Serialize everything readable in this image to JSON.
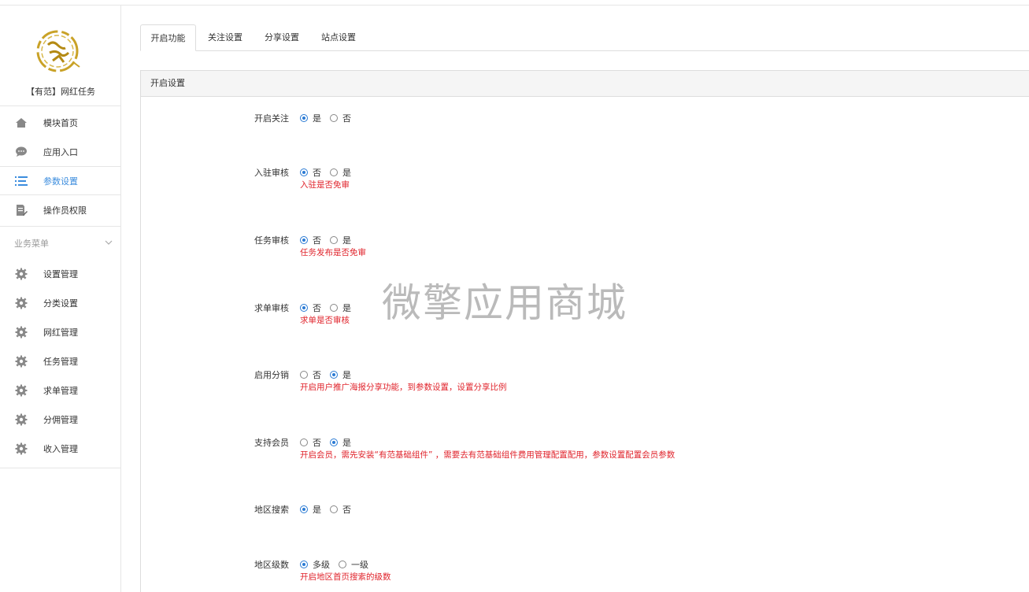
{
  "app_name": "【有范】网红任务",
  "nav": {
    "items": [
      {
        "label": "模块首页",
        "icon": "home-icon"
      },
      {
        "label": "应用入口",
        "icon": "chat-bubble-icon"
      },
      {
        "label": "参数设置",
        "icon": "list-icon"
      },
      {
        "label": "操作员权限",
        "icon": "edit-doc-icon"
      }
    ],
    "section_title": "业务菜单",
    "biz_items": [
      {
        "label": "设置管理",
        "icon": "gear-icon"
      },
      {
        "label": "分类设置",
        "icon": "gear-icon"
      },
      {
        "label": "网红管理",
        "icon": "gear-icon"
      },
      {
        "label": "任务管理",
        "icon": "gear-icon"
      },
      {
        "label": "求单管理",
        "icon": "gear-icon"
      },
      {
        "label": "分佣管理",
        "icon": "gear-icon"
      },
      {
        "label": "收入管理",
        "icon": "gear-icon"
      }
    ]
  },
  "tabs": [
    "开启功能",
    "关注设置",
    "分享设置",
    "站点设置"
  ],
  "panel_title": "开启设置",
  "settings": [
    {
      "label": "开启关注",
      "options": [
        "是",
        "否"
      ],
      "selected": 0,
      "help": ""
    },
    {
      "label": "入驻审核",
      "options": [
        "否",
        "是"
      ],
      "selected": 0,
      "help": "入驻是否免审"
    },
    {
      "label": "任务审核",
      "options": [
        "否",
        "是"
      ],
      "selected": 0,
      "help": "任务发布是否免审"
    },
    {
      "label": "求单审核",
      "options": [
        "否",
        "是"
      ],
      "selected": 0,
      "help": "求单是否审核"
    },
    {
      "label": "启用分销",
      "options": [
        "否",
        "是"
      ],
      "selected": 1,
      "help": "开启用户推广海报分享功能，到参数设置，设置分享比例"
    },
    {
      "label": "支持会员",
      "options": [
        "否",
        "是"
      ],
      "selected": 1,
      "help": "开启会员，需先安装“有范基础组件” ，需要去有范基础组件费用管理配置配用，参数设置配置会员参数"
    },
    {
      "label": "地区搜索",
      "options": [
        "是",
        "否"
      ],
      "selected": 0,
      "help": ""
    },
    {
      "label": "地区级数",
      "options": [
        "多级",
        "一级"
      ],
      "selected": 0,
      "help": "开启地区首页搜索的级数"
    }
  ],
  "watermark": "微擎应用商城",
  "colors": {
    "accent": "#2b7bd4",
    "help": "#e0242c",
    "nav_active": "#3c8dde",
    "logo_gold": "#c9a227"
  }
}
